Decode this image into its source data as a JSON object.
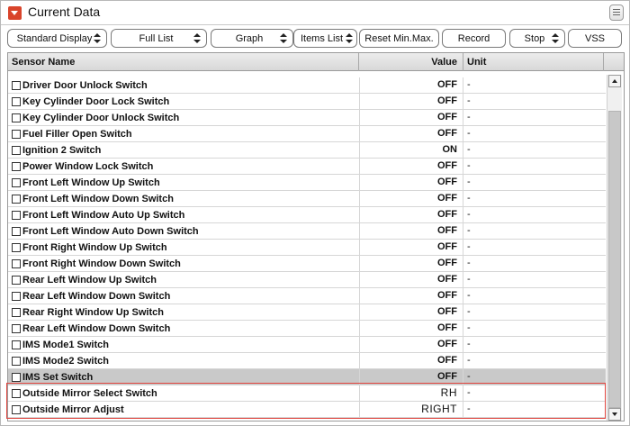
{
  "titlebar": {
    "title": "Current Data",
    "collapse_icon": "chevron-down-icon",
    "menu_icon": "list-menu-icon"
  },
  "toolbar": {
    "standard_display": "Standard Display",
    "full_list": "Full List",
    "graph": "Graph",
    "items_list": "Items List",
    "reset_min_max": "Reset Min.Max.",
    "record": "Record",
    "stop": "Stop",
    "vss": "VSS"
  },
  "table": {
    "headers": {
      "name": "Sensor Name",
      "value": "Value",
      "unit": "Unit"
    },
    "rows": [
      {
        "name": "Driver Door Unlock Switch",
        "value": "OFF",
        "unit": "-"
      },
      {
        "name": "Key Cylinder Door Lock Switch",
        "value": "OFF",
        "unit": "-"
      },
      {
        "name": "Key Cylinder Door Unlock Switch",
        "value": "OFF",
        "unit": "-"
      },
      {
        "name": "Fuel Filler Open Switch",
        "value": "OFF",
        "unit": "-"
      },
      {
        "name": "Ignition 2 Switch",
        "value": "ON",
        "unit": "-"
      },
      {
        "name": "Power Window Lock Switch",
        "value": "OFF",
        "unit": "-"
      },
      {
        "name": "Front Left Window Up Switch",
        "value": "OFF",
        "unit": "-"
      },
      {
        "name": "Front Left Window Down Switch",
        "value": "OFF",
        "unit": "-"
      },
      {
        "name": "Front Left Window Auto Up Switch",
        "value": "OFF",
        "unit": "-"
      },
      {
        "name": "Front Left Window Auto Down Switch",
        "value": "OFF",
        "unit": "-"
      },
      {
        "name": "Front Right Window Up Switch",
        "value": "OFF",
        "unit": "-"
      },
      {
        "name": "Front Right Window Down Switch",
        "value": "OFF",
        "unit": "-"
      },
      {
        "name": "Rear Left Window Up Switch",
        "value": "OFF",
        "unit": "-"
      },
      {
        "name": "Rear Left Window Down Switch",
        "value": "OFF",
        "unit": "-"
      },
      {
        "name": "Rear Right Window Up Switch",
        "value": "OFF",
        "unit": "-"
      },
      {
        "name": "Rear Left Window Down Switch",
        "value": "OFF",
        "unit": "-"
      },
      {
        "name": "IMS Mode1 Switch",
        "value": "OFF",
        "unit": "-"
      },
      {
        "name": "IMS Mode2 Switch",
        "value": "OFF",
        "unit": "-"
      },
      {
        "name": "IMS Set Switch",
        "value": "OFF",
        "unit": "-"
      },
      {
        "name": "Outside Mirror Select Switch",
        "value": "RH",
        "unit": "-"
      },
      {
        "name": "Outside Mirror Adjust",
        "value": "RIGHT",
        "unit": "-"
      }
    ]
  },
  "colors": {
    "accent": "#d9442b",
    "highlight_border": "#e0453f",
    "selected_row": "#c9c9c9"
  }
}
